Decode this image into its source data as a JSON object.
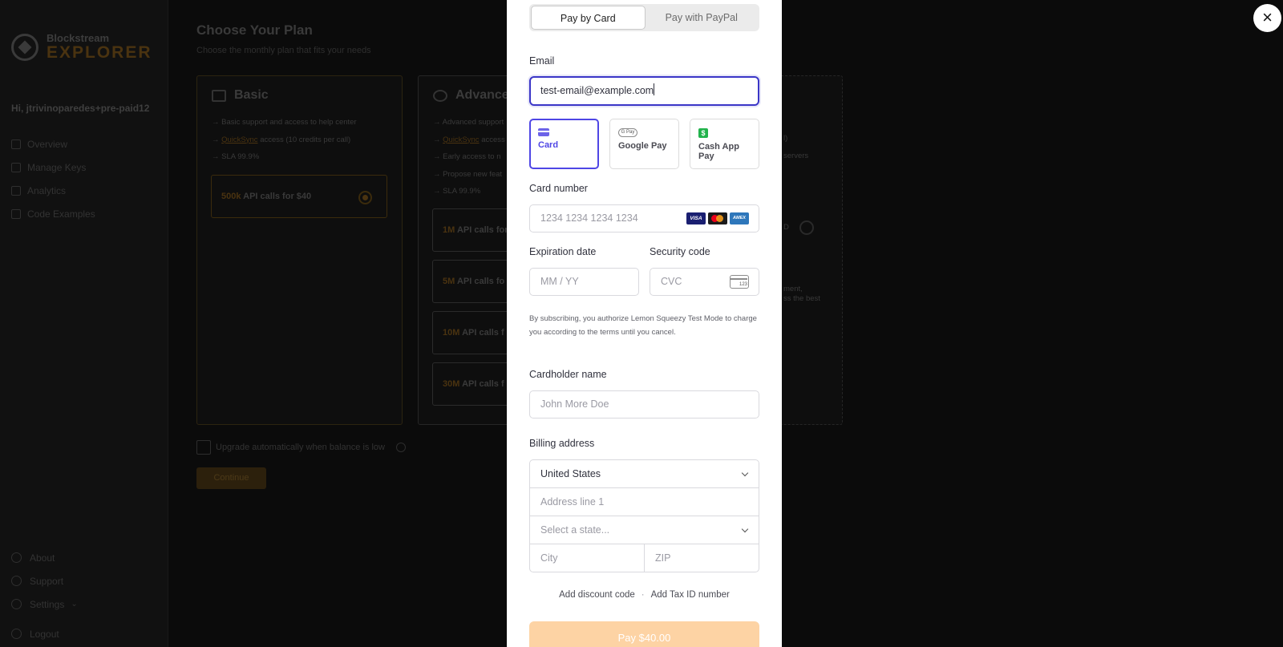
{
  "background": {
    "logo": {
      "line1": "Blockstream",
      "line2": "EXPLORER"
    },
    "greeting": "Hi, jtrivinoparedes+pre-paid12",
    "nav": [
      "Overview",
      "Manage Keys",
      "Analytics",
      "Code Examples"
    ],
    "footer_nav": [
      "About",
      "Support",
      "Settings",
      "Logout"
    ],
    "page_title": "Choose Your Plan",
    "page_subtitle": "Choose the monthly plan that fits your needs",
    "plans": {
      "basic": {
        "name": "Basic",
        "features": [
          "Basic support and access to help center",
          "QuickSync",
          "access (10 credits per call)",
          "SLA 99.9%"
        ],
        "option": {
          "amount": "500k",
          "text": "API calls for $40",
          "selected": true
        }
      },
      "advanced": {
        "name": "Advanced",
        "features": [
          "Advanced support",
          "QuickSync",
          "access",
          "Early access to n",
          "Propose new feat",
          "SLA 99.9%"
        ],
        "options": [
          {
            "amount": "1M",
            "text": "API calls for"
          },
          {
            "amount": "5M",
            "text": "API calls fo"
          },
          {
            "amount": "10M",
            "text": "API calls f"
          },
          {
            "amount": "30M",
            "text": "API calls f"
          }
        ]
      },
      "enterprise": {
        "texts": [
          "l)",
          "servers",
          "D",
          "ment,",
          "ss the best"
        ]
      }
    },
    "upgrade_label": "Upgrade automatically when balance is low",
    "continue_label": "Continue"
  },
  "checkout": {
    "tabs": [
      "Pay by Card",
      "Pay with PayPal"
    ],
    "email_label": "Email",
    "email_value": "test-email@example.com",
    "payment_methods": [
      {
        "label": "Card",
        "icon": "card-icon",
        "active": true
      },
      {
        "label": "Google Pay",
        "icon": "google-pay-icon",
        "active": false
      },
      {
        "label": "Cash App Pay",
        "icon": "cash-app-icon",
        "active": false
      }
    ],
    "card_number_label": "Card number",
    "card_number_placeholder": "1234 1234 1234 1234",
    "card_brands": [
      "VISA",
      "MC",
      "AMEX"
    ],
    "expiry_label": "Expiration date",
    "expiry_placeholder": "MM / YY",
    "security_label": "Security code",
    "security_placeholder": "CVC",
    "cvc_icon_text": "123",
    "terms": "By subscribing, you authorize Lemon Squeezy Test Mode to charge you according to the terms until you cancel.",
    "cardholder_label": "Cardholder name",
    "cardholder_placeholder": "John More Doe",
    "billing_label": "Billing address",
    "country_value": "United States",
    "address_placeholder": "Address line 1",
    "state_placeholder": "Select a state...",
    "city_placeholder": "City",
    "zip_placeholder": "ZIP",
    "discount_link": "Add discount code",
    "separator": "·",
    "tax_link": "Add Tax ID number",
    "pay_label": "Pay $40.00",
    "close_glyph": "×"
  }
}
